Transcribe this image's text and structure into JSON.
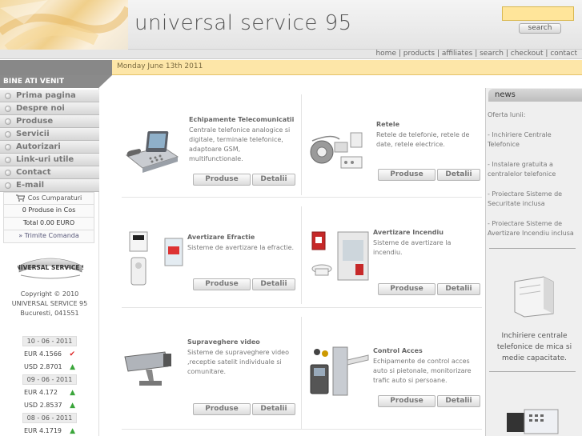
{
  "header": {
    "title": "universal service 95",
    "search_placeholder": "",
    "search_label": "search"
  },
  "topnav": {
    "links": [
      "home",
      "products",
      "affiliates",
      "search",
      "checkout",
      "contact"
    ]
  },
  "datebar": {
    "date": "Monday June 13th 2011"
  },
  "sidebar": {
    "welcome": "BINE ATI VENIT",
    "menu": [
      "Prima pagina",
      "Despre noi",
      "Produse",
      "Servicii",
      "Autorizari",
      "Link-uri utile",
      "Contact",
      "E-mail"
    ],
    "cart": {
      "title": "Cos Cumparaturi",
      "items": "0 Produse in Cos",
      "total": "Total 0.00 EURO",
      "send": "» Trimite Comanda"
    },
    "logo_text": "UNIVERSAL SERVICE 95",
    "copyright": [
      "Copyright © 2010",
      "UNIVERSAL SERVICE 95",
      "Bucuresti, 041551"
    ],
    "fx": [
      {
        "date": "10 - 06 - 2011"
      },
      {
        "rate": "EUR 4.1566",
        "trend": "down"
      },
      {
        "rate": "USD 2.8701",
        "trend": "up"
      },
      {
        "date": "09 - 06 - 2011"
      },
      {
        "rate": "EUR 4.172",
        "trend": "up"
      },
      {
        "rate": "USD 2.8537",
        "trend": "up"
      },
      {
        "date": "08 - 06 - 2011"
      },
      {
        "rate": "EUR 4.1719",
        "trend": "up"
      }
    ]
  },
  "products": [
    {
      "title": "Echipamente Telecomunicatii",
      "desc": "Centrale telefonice analogice si digitale, terminale telefonice, adaptoare GSM, multifunctionale.",
      "btn1": "Produse",
      "btn2": "Detalii"
    },
    {
      "title": "Retele",
      "desc": "Retele de telefonie, retele de date, retele electrice.",
      "btn1": "Produse",
      "btn2": "Detalii"
    },
    {
      "title": "Avertizare Efractie",
      "desc": "Sisteme de avertizare la efractie.",
      "btn1": "Produse",
      "btn2": "Detalii"
    },
    {
      "title": "Avertizare Incendiu",
      "desc": "Sisteme de avertizare la incendiu.",
      "btn1": "Produse",
      "btn2": "Detalii"
    },
    {
      "title": "Supraveghere video",
      "desc": "Sisteme de supraveghere video ,receptie satelit individuale si comunitare.",
      "btn1": "Produse",
      "btn2": "Detalii"
    },
    {
      "title": "Control Acces",
      "desc": "Echipamente de control acces auto si pietonale, monitorizare trafic auto si persoane.",
      "btn1": "Produse",
      "btn2": "Detalii"
    }
  ],
  "news": {
    "heading": "news",
    "intro": "Oferta lunii:",
    "items": [
      "- Inchiriere Centrale Telefonice",
      "- Instalare gratuita a centralelor telefonice",
      "- Proiectare Sisteme de Securitate inclusa",
      "- Proiectare Sisteme de Avertizare Incendiu inclusa"
    ],
    "caption": "Inchiriere centrale telefonice de mica si medie capacitate."
  }
}
